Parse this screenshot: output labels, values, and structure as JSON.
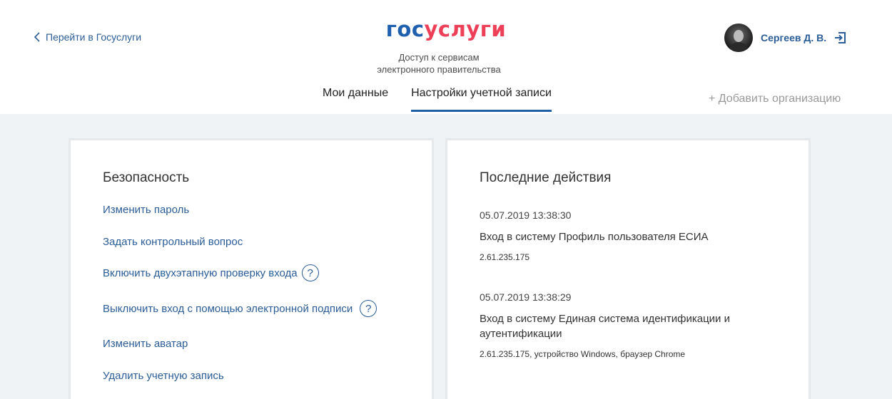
{
  "header": {
    "back_link": "Перейти в Госуслуги",
    "logo": {
      "part1": "гос",
      "part2": "услуги"
    },
    "tagline": [
      "Доступ к сервисам",
      "электронного правительства"
    ],
    "user_name": "Сергеев Д. В.",
    "tabs": [
      {
        "label": "Мои данные",
        "active": false
      },
      {
        "label": "Настройки учетной записи",
        "active": true
      }
    ],
    "add_org": "+ Добавить организацию"
  },
  "security": {
    "title": "Безопасность",
    "links": [
      {
        "label": "Изменить пароль"
      },
      {
        "label": "Задать контрольный вопрос"
      },
      {
        "label": "Включить двухэтапную проверку входа",
        "help": "?"
      },
      {
        "label": "Выключить вход с помощью электронной подписи",
        "help": "?"
      },
      {
        "label": "Изменить аватар"
      },
      {
        "label": "Удалить учетную запись"
      }
    ]
  },
  "activity": {
    "title": "Последние действия",
    "items": [
      {
        "date": "05.07.2019 13:38:30",
        "title": "Вход в систему Профиль пользователя ЕСИА",
        "meta": "2.61.235.175"
      },
      {
        "date": "05.07.2019 13:38:29",
        "title": "Вход в систему Единая система идентификации и аутентификации",
        "meta": "2.61.235.175, устройство Windows, браузер Chrome"
      }
    ]
  },
  "colors": {
    "brand_blue": "#1e5fae",
    "brand_red": "#ee3f58",
    "link": "#2b5d98"
  },
  "icons": {
    "back": "chevron-left-icon",
    "logout": "logout-icon",
    "help": "help-circle-icon"
  }
}
